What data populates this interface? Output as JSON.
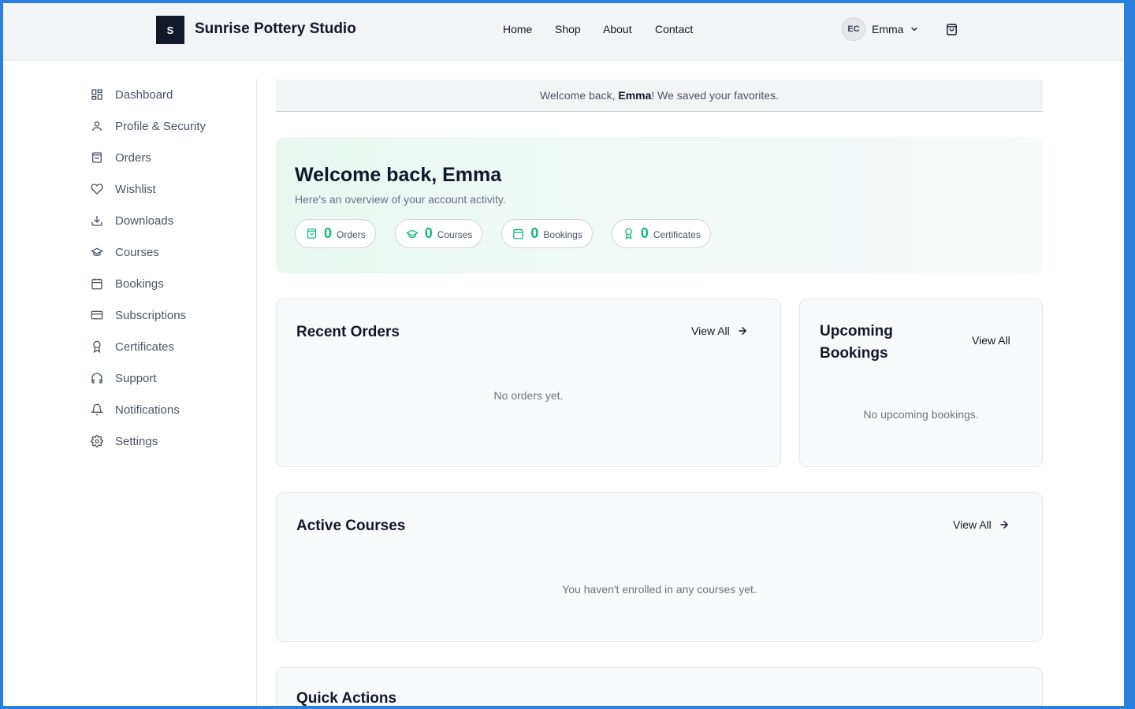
{
  "header": {
    "logo_letter": "S",
    "brand": "Sunrise Pottery Studio",
    "nav": [
      "Home",
      "Shop",
      "About",
      "Contact"
    ],
    "user_initials": "EC",
    "user_name": "Emma"
  },
  "sidebar": {
    "items": [
      {
        "label": "Dashboard",
        "icon": "dashboard-icon"
      },
      {
        "label": "Profile & Security",
        "icon": "user-icon"
      },
      {
        "label": "Orders",
        "icon": "bag-icon"
      },
      {
        "label": "Wishlist",
        "icon": "heart-icon"
      },
      {
        "label": "Downloads",
        "icon": "download-icon"
      },
      {
        "label": "Courses",
        "icon": "graduation-cap-icon"
      },
      {
        "label": "Bookings",
        "icon": "calendar-icon"
      },
      {
        "label": "Subscriptions",
        "icon": "credit-card-icon"
      },
      {
        "label": "Certificates",
        "icon": "award-icon"
      },
      {
        "label": "Support",
        "icon": "headphones-icon"
      },
      {
        "label": "Notifications",
        "icon": "bell-icon"
      },
      {
        "label": "Settings",
        "icon": "gear-icon"
      }
    ]
  },
  "banner": {
    "prefix": "Welcome back, ",
    "name": "Emma",
    "suffix": "! We saved your favorites."
  },
  "hero": {
    "title": "Welcome back, Emma",
    "subtitle": "Here's an overview of your account activity.",
    "stats": [
      {
        "value": "0",
        "label": "Orders",
        "icon": "bag-icon"
      },
      {
        "value": "0",
        "label": "Courses",
        "icon": "graduation-cap-icon"
      },
      {
        "value": "0",
        "label": "Bookings",
        "icon": "calendar-icon"
      },
      {
        "value": "0",
        "label": "Certificates",
        "icon": "award-icon"
      }
    ]
  },
  "recent_orders": {
    "title": "Recent Orders",
    "view_all": "View All",
    "empty": "No orders yet."
  },
  "upcoming_bookings": {
    "title_line1": "Upcoming",
    "title_line2": "Bookings",
    "view_all": "View All",
    "empty": "No upcoming bookings."
  },
  "active_courses": {
    "title": "Active Courses",
    "view_all": "View All",
    "empty": "You haven't enrolled in any courses yet."
  },
  "quick_actions": {
    "title": "Quick Actions"
  },
  "colors": {
    "accent": "#10b981",
    "frame": "#2b7fde",
    "logo_bg": "#111827"
  }
}
